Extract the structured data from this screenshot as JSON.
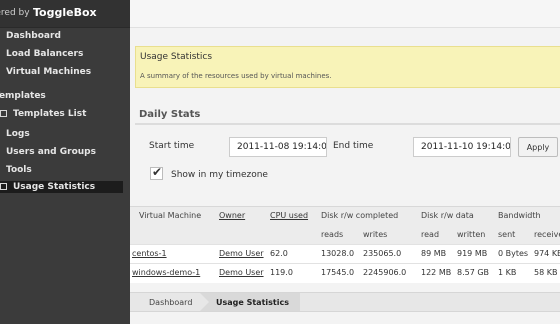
{
  "brand": {
    "prefix": "wered by",
    "name": "ToggleBox"
  },
  "sidebar": {
    "items": [
      {
        "label": "Dashboard"
      },
      {
        "label": "Load Balancers"
      },
      {
        "label": "Virtual Machines"
      },
      {
        "label": "Templates"
      },
      {
        "label": "Templates List"
      },
      {
        "label": "Logs"
      },
      {
        "label": "Users and Groups"
      },
      {
        "label": "Tools"
      },
      {
        "label": "Usage Statistics",
        "selected": true
      }
    ]
  },
  "notice": {
    "title": "Usage Statistics",
    "description": "A summary of the resources used by virtual machines."
  },
  "stats": {
    "heading": "Daily Stats",
    "start_label": "Start time",
    "start_value": "2011-11-08 19:14:08",
    "end_label": "End time",
    "end_value": "2011-11-10 19:14:08",
    "apply_label": "Apply",
    "timezone_label": "Show in my timezone",
    "timezone_checked": true
  },
  "table": {
    "headers": [
      "Virtual Machine",
      "Owner",
      "CPU used",
      "Disk r/w completed",
      "Disk r/w data",
      "Bandwidth"
    ],
    "subheaders": [
      "reads",
      "writes",
      "read",
      "written",
      "sent",
      "received"
    ],
    "rows": [
      [
        "centos-1",
        "Demo User",
        "62.0",
        "13028.0",
        "235065.0",
        "89 MB",
        "919 MB",
        "0 Bytes",
        "974 KB"
      ],
      [
        "windows-demo-1",
        "Demo User",
        "119.0",
        "17545.0",
        "2245906.0",
        "122 MB",
        "8.57 GB",
        "1 KB",
        "58 KB"
      ]
    ]
  },
  "breadcrumb": {
    "home": "Dashboard",
    "current": "Usage Statistics"
  },
  "colors": {
    "sidebar": "#3b3b3b",
    "notice_bg": "#f8f3b8",
    "selected_nav": "#1c1c1c"
  }
}
